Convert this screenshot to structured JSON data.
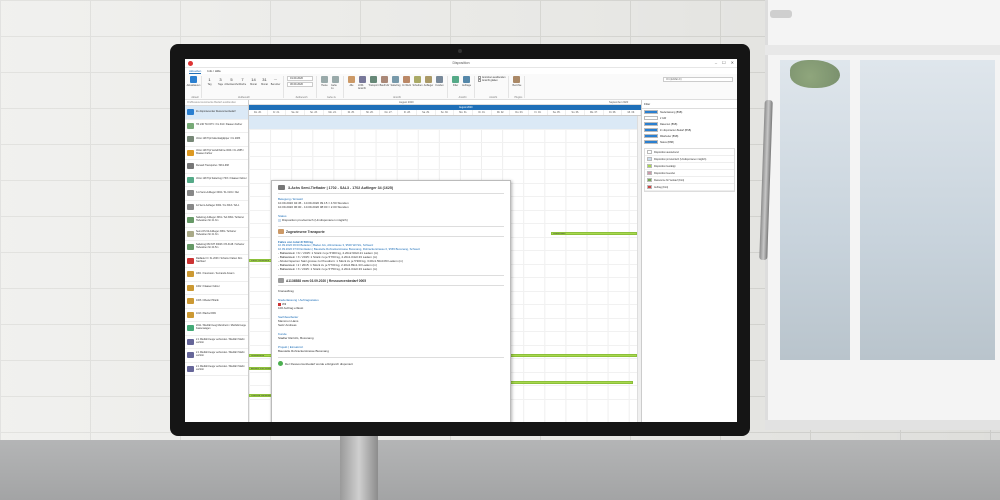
{
  "app": {
    "title": "Disposition",
    "window_buttons": [
      "–",
      "☐",
      "✕"
    ]
  },
  "menu": [
    "Aktuellen",
    "Info / Hilfe"
  ],
  "ribbon": {
    "search_placeholder": "Ort (E/Mal d/)",
    "groups": [
      {
        "label": "Aktuell",
        "buttons": [
          {
            "label": "Aktualisieren",
            "color": "#2a7fd0"
          }
        ]
      },
      {
        "label": "Zeitbereich",
        "buttons": [
          {
            "num": "1",
            "label": "Tag"
          },
          {
            "num": "3",
            "label": "Tage"
          },
          {
            "num": "5",
            "label": "Arbeitswoche"
          },
          {
            "num": "7",
            "label": "Woche"
          },
          {
            "num": "14",
            "label": "Monat"
          },
          {
            "num": "31",
            "label": "Monat"
          },
          {
            "num": "···",
            "label": "Benutzer"
          }
        ]
      },
      {
        "label": "Zeitbereich",
        "dates": [
          "01.09.2020",
          "30.09.2020"
        ]
      },
      {
        "label": "Gehe zu",
        "buttons": [
          {
            "label": "Heute",
            "color": "#9aa"
          },
          {
            "label": "Gehe zu",
            "color": "#9aa"
          }
        ]
      },
      {
        "label": "Ansicht",
        "buttons": [
          {
            "label": "Alle",
            "color": "#c96"
          },
          {
            "label": "LKW-Ansicht",
            "color": "#779"
          },
          {
            "label": "Transport",
            "color": "#687"
          },
          {
            "label": "Bau/Fuhr",
            "color": "#a87"
          },
          {
            "label": "Sattelzug",
            "color": "#79a"
          },
          {
            "label": "Im Werk",
            "color": "#b86"
          },
          {
            "label": "Scheiben",
            "color": "#aa6"
          },
          {
            "label": "Auflieger",
            "color": "#a96"
          },
          {
            "label": "Kunden",
            "color": "#789"
          }
        ]
      },
      {
        "label": "Ansicht",
        "buttons": [
          {
            "label": "Filter",
            "color": "#5a8"
          },
          {
            "label": "Auftrage",
            "color": "#58a"
          }
        ]
      },
      {
        "label": "Ansicht",
        "checks": [
          "Anordnen ausblenden",
          "Ansicht glatten"
        ]
      },
      {
        "label": "Plugins",
        "buttons": [
          {
            "label": "Berichte",
            "color": "#a86"
          }
        ]
      }
    ]
  },
  "resource_search": "Ort/Ressourcenstrecke Bedarf ausblenden",
  "resources": [
    {
      "name": "Zu disponierender Ressourcenbedarf",
      "color": "#2a7fd0",
      "hl": true
    },
    {
      "name": "HK 240 T10 DTC / KL 344 / Klaasen Fahrer",
      "color": "#7a7"
    },
    {
      "name": "Volvo 128 Tipt Faltenbalgkipper / KL 2083",
      "color": "#787"
    },
    {
      "name": "Volvo 128 Tipt Verleihbühne 0001 / KL 2085 / Klaasen Fahrer",
      "color": "#d92"
    },
    {
      "name": "Renault Transporter / MK1-938",
      "color": "#777"
    },
    {
      "name": "Volvo 128 Tipt Sattelzug / HK3 / Klaasen Fahrer",
      "color": "#5a8"
    },
    {
      "name": "3-A Semi-Auflieger 0002 / KL 0101 / Niel",
      "color": "#888"
    },
    {
      "name": "4A Semi-Auflieger 3062 / KL 3013 / NA-1",
      "color": "#888"
    },
    {
      "name": "Sattelzug Auflieger 3061 / SA 3062 / Scharrer Hebeleben für 21.3m",
      "color": "#696"
    },
    {
      "name": "Semi-OS 62 Auflieger 3081 / Scharrer Hebeleben für 21.3m",
      "color": "#aa8"
    },
    {
      "name": "Sattelzug DM 33T 30026 / PA 3128 / Scharrer Hebeleben für 24.5m",
      "color": "#696"
    },
    {
      "name": "Radlader 0 / KL 2003 / Scharrer Kalten 3km Nachlauf",
      "color": "#c33"
    },
    {
      "name": "1801 / Kiesmann / Fernando Amann",
      "color": "#c93"
    },
    {
      "name": "1002 / Klaasen Fahrer",
      "color": "#c93"
    },
    {
      "name": "1006 / Wieder Pillarik",
      "color": "#c93"
    },
    {
      "name": "1013 / Bachel RPA",
      "color": "#c93"
    },
    {
      "name": "2011 / Mietfahrzeug Mannheim / Mietfahrzeuge Kastenwagen",
      "color": "#4a7"
    },
    {
      "name": "2.1 Mietfahrzeuge verbunden / Mietfahr Markt verlinkt",
      "color": "#669"
    },
    {
      "name": "2.1 Mietfahrzeuge verbunden / Mietfahr Markt verlinkt",
      "color": "#669"
    },
    {
      "name": "2.1 Mietfahrzeuge verbunden / Mietfahr Markt verlinkt",
      "color": "#669"
    }
  ],
  "timeline": {
    "months": [
      "August 2020",
      "September 2020"
    ],
    "week_band": "August 2020",
    "days": [
      "Do. 20.",
      "Fr. 21.",
      "Sa. 22.",
      "So. 23.",
      "Mo. 24.",
      "Di. 25.",
      "Mi. 26.",
      "Do. 27.",
      "Fr. 28.",
      "Sa. 29.",
      "So. 30.",
      "Mo. 31.",
      "Di. 01.",
      "Mi. 02.",
      "Do. 03.",
      "Fr. 04.",
      "Sa. 05.",
      "So. 06.",
      "Mo. 07.",
      "Di. 08.",
      "Mi. 09."
    ],
    "bars": [
      {
        "row": 8,
        "text": "Dispensation",
        "start": 0.77,
        "width": 0.22
      },
      {
        "row": 10,
        "text": "Fahrer Vermietung",
        "start": 0.0,
        "width": 0.07
      },
      {
        "row": 17,
        "text": "Dispositionen",
        "start": 0.0,
        "width": 0.99
      },
      {
        "row": 18,
        "text": "Ausfahrt Kran verkehrt 1 - Baustelle AG, Luzern",
        "start": 0.0,
        "width": 0.45
      },
      {
        "row": 19,
        "text": "Ausfahrt Kran verkehrt 2",
        "start": 0.4,
        "width": 0.58
      },
      {
        "row": 20,
        "text": "Lieferung (Bauaufgabe) 1 - Baustelle AG, Luzern",
        "start": 0.0,
        "width": 0.15
      },
      {
        "row": 20,
        "text": "Lieferung (Bauaufgabe) 2",
        "start": 0.4,
        "width": 0.15
      }
    ]
  },
  "right_panel": {
    "title": "Filter",
    "filters": [
      {
        "label": "Niederlassung (BSB)",
        "color": "#2a7fd0"
      },
      {
        "label": "2 GW",
        "color": "#fff"
      },
      {
        "label": "Rasenten (BSB)",
        "color": "#2a7fd0"
      },
      {
        "label": "Im disponierten Bedarf (BSB)",
        "color": "#2a7fd0"
      },
      {
        "label": "Mitarbeiter (BSB)",
        "color": "#2a7fd0"
      },
      {
        "label": "Status (BSB)",
        "color": "#2a7fd0"
      }
    ],
    "legend": [
      {
        "label": "Disposition ausstehend",
        "color": "#fff"
      },
      {
        "label": "Disposition provisorisch (Umdisponieren möglich)",
        "color": "#cde"
      },
      {
        "label": "Disposition bestätigt",
        "color": "#a8d84e"
      },
      {
        "label": "Disposition beendet",
        "color": "#c9a"
      },
      {
        "label": "Ressource für Verkauf (Ktnt)",
        "color": "#7a5"
      },
      {
        "label": "Auftrag (Ktnt)",
        "color": "#c44"
      }
    ]
  },
  "popup": {
    "title": "3-Achs Semi-Tieflader | 1702 - SAL3 - 1702 Auflieger 34 (1625)",
    "belegung_label": "Belegung / Einsatz",
    "belegung_lines": [
      "10.09.2020 04:45 - 10.09.2020 09.15 = 4.50 Stunden",
      "10.09.2020 06:00 - 10.09.2020 08:00 = 2.00 Stunden"
    ],
    "status_label": "Status",
    "status_value": "Disposition provisorisch (Umdisponieren möglich)",
    "transports_title": "Zugewiesene Transporte",
    "fahrt_title": "Fahre von total 3/ 500 kg",
    "fahrt_lines": [
      "10.09.2020 06:00 Beladen | Baden AG, Allmstrasse 3, 9500 Wil SG, Schweiz",
      "10.09.2020 07:00 Entladen | Baustelle Rohrackerstrasse Bussnang, Rohrackerstrasse 0, 9565 Bussnang, Schweiz"
    ],
    "fahrt_items": [
      "- Ballaststein / Kr / 2015: 1 Stück zu je 5'000 kg, 2.20x2.90x0.21 Ladem (m)",
      "- Ballaststein / X / 2015: 1 Stück zu je 5'700 kg, 2.20x1.04x0.33 Ladem (m)",
      "- Absturzsperren Satz grosse zu Preudrein: 1 Stück zu je 5'300 kg, 3.00x1.50x0.80 Ladem (m)",
      "- Ballaststein / 2 / 2015: 1 Stück zu je 5'700 kg, 2.20x2.89x1.33 Ladem (m)",
      "- Ballaststein / X / 2015: 1 Stück zu je 5'750 kg, 2.20x1.04x0.33 Ladem (m)"
    ],
    "bedarf_title": "A1136588 vom 03.09.2020 | Ressourcenbedarf 0005",
    "bedarf_type": "Kranauftrag",
    "niederlassung_label": "Niederlassung / Auftragsstatus",
    "niederlassung_value": "Wil",
    "auftrag_value": "100 Auftrag erfasst",
    "sachbearbeiter_label": "Sachbearbeiter",
    "sachbearbeiter_lines": [
      "Mammon Hans",
      "Seitz Andreas"
    ],
    "kunde_label": "Kunde",
    "kunde_value": "Stadler Rail AG, Bussnang",
    "projekt_label": "Projekt | Einsatzort",
    "projekt_value": "Baustelle Rohrackerstrasse Bussnang",
    "footer": "Der Ressourcenbedarf wurde erfolgreich disponiert"
  }
}
